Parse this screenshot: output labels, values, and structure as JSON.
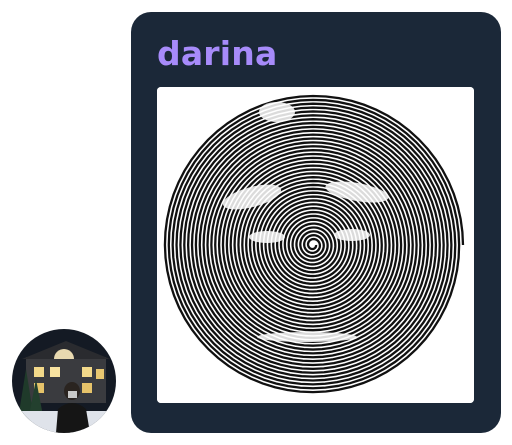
{
  "message": {
    "sender_name": "darina",
    "sender_color": "#a78bfa",
    "bubble_color": "#1b2838",
    "attachment": {
      "type": "image",
      "description_icon": "spiral-portrait-image"
    }
  },
  "avatar": {
    "icon": "user-avatar-photo"
  }
}
